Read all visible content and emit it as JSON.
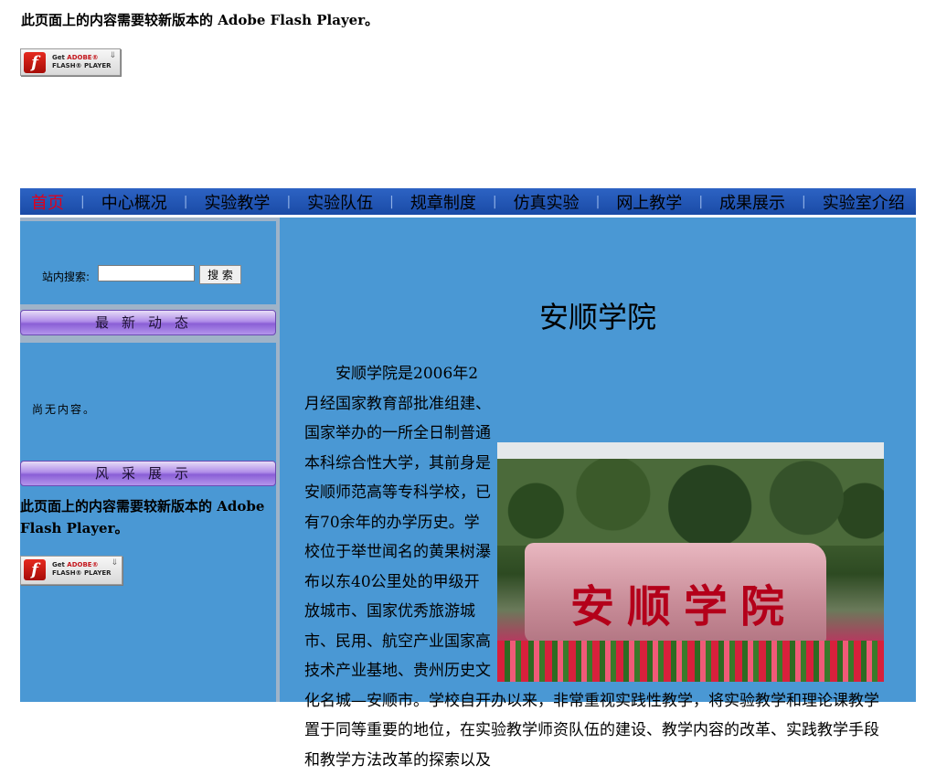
{
  "flash_notice": "此页面上的内容需要较新版本的 Adobe Flash Player。",
  "flash_button": {
    "line1": "Get",
    "brand": "ADOBE®",
    "line2": "FLASH® PLAYER",
    "arrow": "⇓"
  },
  "nav": {
    "items": [
      {
        "label": "首页",
        "active": true
      },
      {
        "label": "中心概况"
      },
      {
        "label": "实验教学"
      },
      {
        "label": "实验队伍"
      },
      {
        "label": "规章制度"
      },
      {
        "label": "仿真实验"
      },
      {
        "label": "网上教学"
      },
      {
        "label": "成果展示"
      },
      {
        "label": "实验室介绍"
      }
    ],
    "separator": "|"
  },
  "sidebar": {
    "search_label": "站内搜索:",
    "search_value": "",
    "search_button": "搜 索",
    "news_title": "最新动态",
    "news_empty": "尚无内容。",
    "gallery_title": "风采展示",
    "gallery_flash_notice": "此页面上的内容需要较新版本的 Adobe Flash Player。"
  },
  "main": {
    "title": "安顺学院",
    "paragraph": "安顺学院是2006年2月经国家教育部批准组建、国家举办的一所全日制普通本科综合性大学，其前身是安顺师范高等专科学校，已有70余年的办学历史。学校位于举世闻名的黄果树瀑布以东40公里处的甲级开放城市、国家优秀旅游城市、民用、航空产业国家高技术产业基地、贵州历史文化名城—安顺市。学校自开办以来，非常重视实践性教学，将实验教学和理论课教学置于同等重要的地位，在实验教学师资队伍的建设、教学内容的改革、实践教学手段和教学方法改革的探索以及",
    "photo_caption": "安顺学院"
  }
}
